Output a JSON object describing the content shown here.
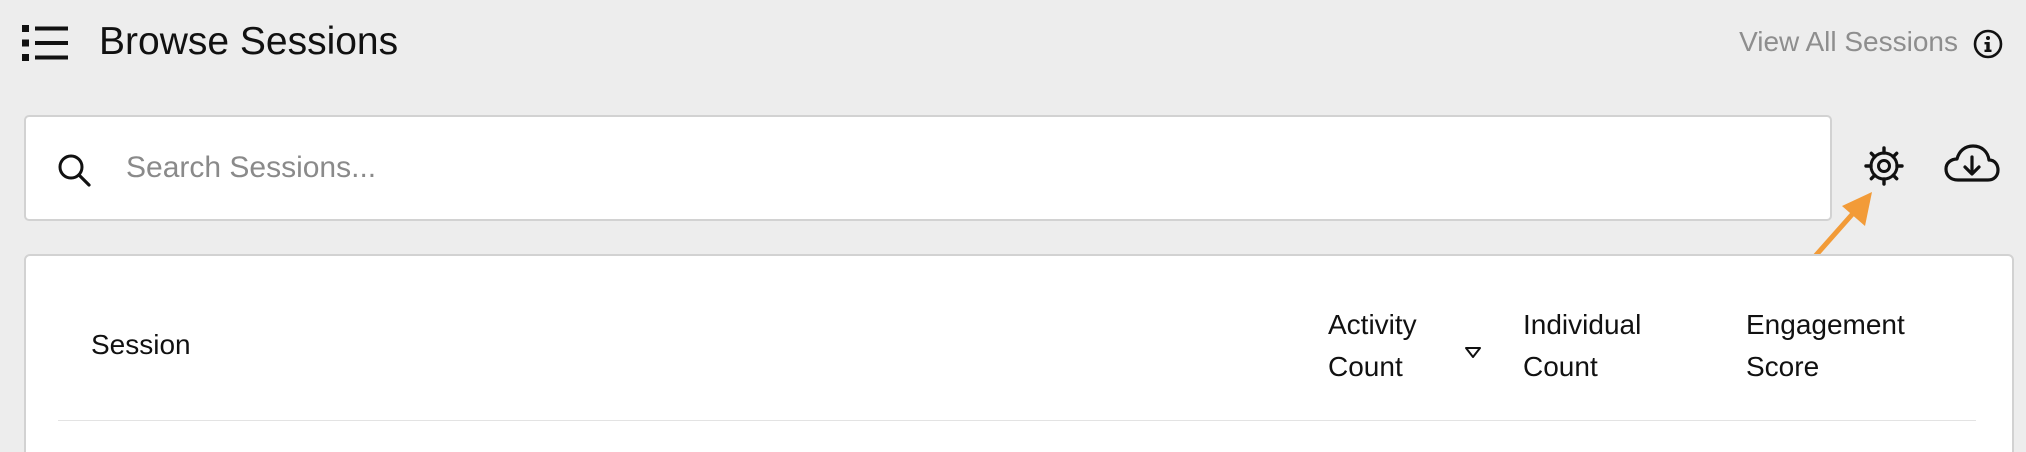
{
  "header": {
    "title": "Browse Sessions",
    "view_all_label": "View All Sessions",
    "menu_icon": "list-icon",
    "info_icon": "info-icon"
  },
  "search": {
    "placeholder": "Search Sessions...",
    "value": "",
    "icon": "search-icon"
  },
  "toolbar": {
    "settings_icon": "gear-icon",
    "download_icon": "cloud-download-icon"
  },
  "annotation": {
    "color": "#f29b38"
  },
  "table": {
    "columns": [
      {
        "line1": "Session",
        "line2": ""
      },
      {
        "line1": "Activity",
        "line2": "Count",
        "sort": "descending"
      },
      {
        "line1": "Individual",
        "line2": "Count"
      },
      {
        "line1": "Engagement",
        "line2": "Score"
      }
    ]
  }
}
